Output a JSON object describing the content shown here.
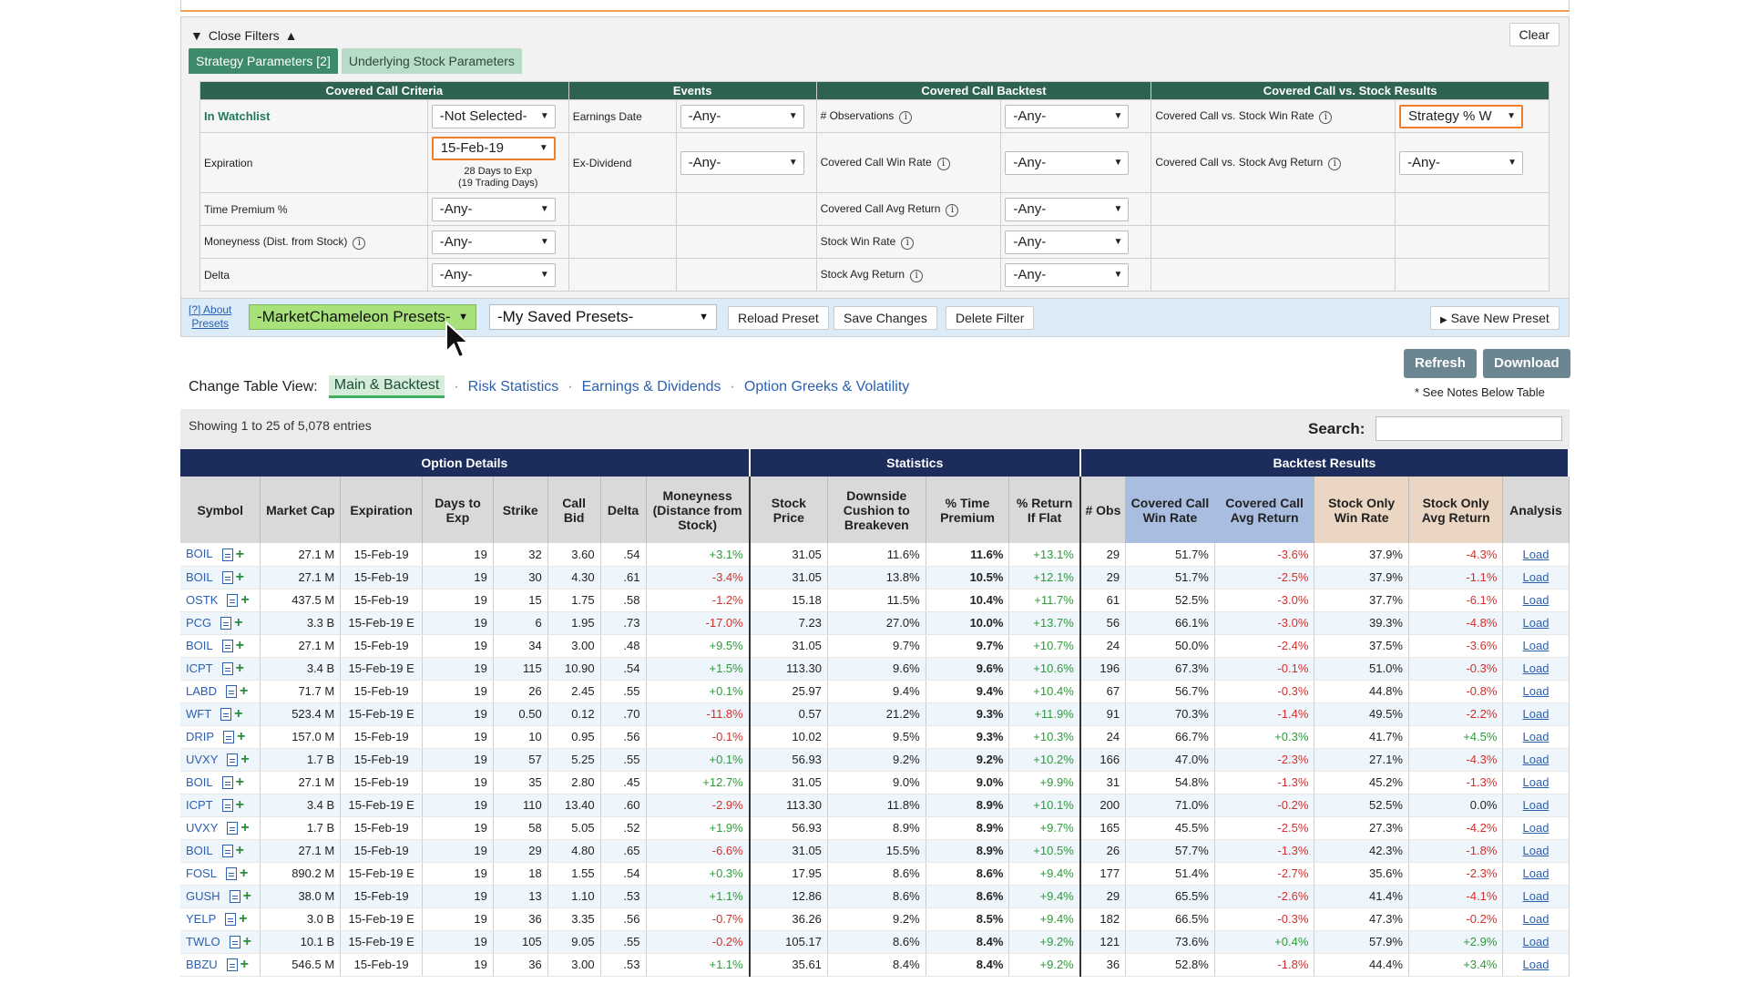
{
  "filters": {
    "close_label": "Close Filters",
    "clear_label": "Clear",
    "tabs": [
      "Strategy Parameters [2]",
      "Underlying Stock Parameters"
    ],
    "groups": [
      "Covered Call Criteria",
      "Events",
      "Covered Call Backtest",
      "Covered Call vs. Stock Results"
    ],
    "rows": [
      {
        "c1": "In Watchlist",
        "v1": "-Not Selected-",
        "c2": "Earnings Date",
        "v2": "-Any-",
        "c3": "# Observations",
        "v3": "-Any-",
        "c4": "Covered Call vs. Stock Win Rate",
        "v4": "Strategy % W"
      },
      {
        "c1": "Expiration",
        "v1": "15-Feb-19",
        "note1": "28 Days to Exp",
        "note2": "(19 Trading Days)",
        "c2": "Ex-Dividend",
        "v2": "-Any-",
        "c3": "Covered Call Win Rate",
        "v3": "-Any-",
        "c4": "Covered Call vs. Stock Avg Return",
        "v4": "-Any-"
      },
      {
        "c1": "Time Premium %",
        "v1": "-Any-",
        "c3": "Covered Call Avg Return",
        "v3": "-Any-"
      },
      {
        "c1": "Moneyness (Dist. from Stock)",
        "v1": "-Any-",
        "c3": "Stock Win Rate",
        "v3": "-Any-"
      },
      {
        "c1": "Delta",
        "v1": "-Any-",
        "c3": "Stock Avg Return",
        "v3": "-Any-"
      }
    ],
    "about_presets_1": "[?] About",
    "about_presets_2": "Presets",
    "presets_mc": "-MarketChameleon Presets-",
    "presets_saved": "-My Saved Presets-",
    "reload": "Reload Preset",
    "save_changes": "Save Changes",
    "delete_filter": "Delete Filter",
    "save_new": "Save New Preset"
  },
  "toolbar": {
    "refresh": "Refresh",
    "download": "Download",
    "notes": "* See Notes Below Table",
    "view_label": "Change Table View:",
    "views": [
      "Main & Backtest",
      "Risk Statistics",
      "Earnings & Dividends",
      "Option Greeks & Volatility"
    ]
  },
  "listing": {
    "showing": "Showing 1 to 25 of 5,078 entries",
    "search_label": "Search:"
  },
  "table": {
    "groups": [
      "Option Details",
      "Statistics",
      "Backtest Results"
    ],
    "headers": [
      "Symbol",
      "Market Cap",
      "Expiration",
      "Days to Exp",
      "Strike",
      "Call Bid",
      "Delta",
      "Moneyness (Distance from Stock)",
      "Stock Price",
      "Downside Cushion to Breakeven",
      "% Time Premium",
      "% Return If Flat",
      "# Obs",
      "Covered Call Win Rate",
      "Covered Call Avg Return",
      "Stock Only Win Rate",
      "Stock Only Avg Return",
      "Analysis"
    ],
    "rows": [
      [
        "BOIL",
        "27.1 M",
        "15-Feb-19",
        "19",
        "32",
        "3.60",
        ".54",
        "+3.1%",
        "31.05",
        "11.6%",
        "11.6%",
        "+13.1%",
        "29",
        "51.7%",
        "-3.6%",
        "37.9%",
        "-4.3%",
        "Load"
      ],
      [
        "BOIL",
        "27.1 M",
        "15-Feb-19",
        "19",
        "30",
        "4.30",
        ".61",
        "-3.4%",
        "31.05",
        "13.8%",
        "10.5%",
        "+12.1%",
        "29",
        "51.7%",
        "-2.5%",
        "37.9%",
        "-1.1%",
        "Load"
      ],
      [
        "OSTK",
        "437.5 M",
        "15-Feb-19",
        "19",
        "15",
        "1.75",
        ".58",
        "-1.2%",
        "15.18",
        "11.5%",
        "10.4%",
        "+11.7%",
        "61",
        "52.5%",
        "-3.0%",
        "37.7%",
        "-6.1%",
        "Load"
      ],
      [
        "PCG",
        "3.3 B",
        "15-Feb-19 E",
        "19",
        "6",
        "1.95",
        ".73",
        "-17.0%",
        "7.23",
        "27.0%",
        "10.0%",
        "+13.7%",
        "56",
        "66.1%",
        "-3.0%",
        "39.3%",
        "-4.8%",
        "Load"
      ],
      [
        "BOIL",
        "27.1 M",
        "15-Feb-19",
        "19",
        "34",
        "3.00",
        ".48",
        "+9.5%",
        "31.05",
        "9.7%",
        "9.7%",
        "+10.7%",
        "24",
        "50.0%",
        "-2.4%",
        "37.5%",
        "-3.6%",
        "Load"
      ],
      [
        "ICPT",
        "3.4 B",
        "15-Feb-19 E",
        "19",
        "115",
        "10.90",
        ".54",
        "+1.5%",
        "113.30",
        "9.6%",
        "9.6%",
        "+10.6%",
        "196",
        "67.3%",
        "-0.1%",
        "51.0%",
        "-0.3%",
        "Load"
      ],
      [
        "LABD",
        "71.7 M",
        "15-Feb-19",
        "19",
        "26",
        "2.45",
        ".55",
        "+0.1%",
        "25.97",
        "9.4%",
        "9.4%",
        "+10.4%",
        "67",
        "56.7%",
        "-0.3%",
        "44.8%",
        "-0.8%",
        "Load"
      ],
      [
        "WFT",
        "523.4 M",
        "15-Feb-19 E",
        "19",
        "0.50",
        "0.12",
        ".70",
        "-11.8%",
        "0.57",
        "21.2%",
        "9.3%",
        "+11.9%",
        "91",
        "70.3%",
        "-1.4%",
        "49.5%",
        "-2.2%",
        "Load"
      ],
      [
        "DRIP",
        "157.0 M",
        "15-Feb-19",
        "19",
        "10",
        "0.95",
        ".56",
        "-0.1%",
        "10.02",
        "9.5%",
        "9.3%",
        "+10.3%",
        "24",
        "66.7%",
        "+0.3%",
        "41.7%",
        "+4.5%",
        "Load"
      ],
      [
        "UVXY",
        "1.7 B",
        "15-Feb-19",
        "19",
        "57",
        "5.25",
        ".55",
        "+0.1%",
        "56.93",
        "9.2%",
        "9.2%",
        "+10.2%",
        "166",
        "47.0%",
        "-2.3%",
        "27.1%",
        "-4.3%",
        "Load"
      ],
      [
        "BOIL",
        "27.1 M",
        "15-Feb-19",
        "19",
        "35",
        "2.80",
        ".45",
        "+12.7%",
        "31.05",
        "9.0%",
        "9.0%",
        "+9.9%",
        "31",
        "54.8%",
        "-1.3%",
        "45.2%",
        "-1.3%",
        "Load"
      ],
      [
        "ICPT",
        "3.4 B",
        "15-Feb-19 E",
        "19",
        "110",
        "13.40",
        ".60",
        "-2.9%",
        "113.30",
        "11.8%",
        "8.9%",
        "+10.1%",
        "200",
        "71.0%",
        "-0.2%",
        "52.5%",
        "0.0%",
        "Load"
      ],
      [
        "UVXY",
        "1.7 B",
        "15-Feb-19",
        "19",
        "58",
        "5.05",
        ".52",
        "+1.9%",
        "56.93",
        "8.9%",
        "8.9%",
        "+9.7%",
        "165",
        "45.5%",
        "-2.5%",
        "27.3%",
        "-4.2%",
        "Load"
      ],
      [
        "BOIL",
        "27.1 M",
        "15-Feb-19",
        "19",
        "29",
        "4.80",
        ".65",
        "-6.6%",
        "31.05",
        "15.5%",
        "8.9%",
        "+10.5%",
        "26",
        "57.7%",
        "-1.3%",
        "42.3%",
        "-1.8%",
        "Load"
      ],
      [
        "FOSL",
        "890.2 M",
        "15-Feb-19 E",
        "19",
        "18",
        "1.55",
        ".54",
        "+0.3%",
        "17.95",
        "8.6%",
        "8.6%",
        "+9.4%",
        "177",
        "51.4%",
        "-2.7%",
        "35.6%",
        "-2.3%",
        "Load"
      ],
      [
        "GUSH",
        "38.0 M",
        "15-Feb-19",
        "19",
        "13",
        "1.10",
        ".53",
        "+1.1%",
        "12.86",
        "8.6%",
        "8.6%",
        "+9.4%",
        "29",
        "65.5%",
        "-2.6%",
        "41.4%",
        "-4.1%",
        "Load"
      ],
      [
        "YELP",
        "3.0 B",
        "15-Feb-19 E",
        "19",
        "36",
        "3.35",
        ".56",
        "-0.7%",
        "36.26",
        "9.2%",
        "8.5%",
        "+9.4%",
        "182",
        "66.5%",
        "-0.3%",
        "47.3%",
        "-0.2%",
        "Load"
      ],
      [
        "TWLO",
        "10.1 B",
        "15-Feb-19 E",
        "19",
        "105",
        "9.05",
        ".55",
        "-0.2%",
        "105.17",
        "8.6%",
        "8.4%",
        "+9.2%",
        "121",
        "73.6%",
        "+0.4%",
        "57.9%",
        "+2.9%",
        "Load"
      ],
      [
        "BBZU",
        "546.5 M",
        "15-Feb-19",
        "19",
        "36",
        "3.00",
        ".53",
        "+1.1%",
        "35.61",
        "8.4%",
        "8.4%",
        "+9.2%",
        "36",
        "52.8%",
        "-1.8%",
        "44.4%",
        "+3.4%",
        "Load"
      ]
    ]
  }
}
